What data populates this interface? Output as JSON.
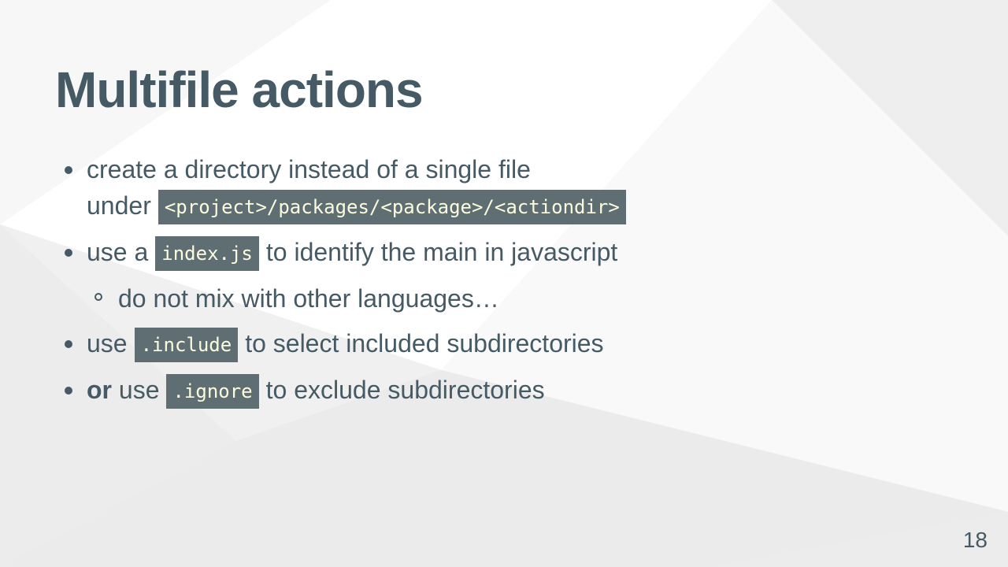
{
  "slide": {
    "title": "Multifile actions",
    "page_number": "18"
  },
  "bullets": {
    "b1": {
      "text1": "create a directory instead of a single file",
      "text2": "under",
      "code": "<project>/packages/<package>/<actiondir>"
    },
    "b2": {
      "pre": "use a",
      "code": "index.js",
      "post": "to identify the main in javascript",
      "sub": "do not mix with other languages…"
    },
    "b3": {
      "pre": "use",
      "code": ".include",
      "post": "to select included subdirectories"
    },
    "b4": {
      "bold": "or",
      "pre": "use",
      "code": ".ignore",
      "post": "to exclude subdirectories"
    }
  },
  "colors": {
    "text": "#455a64",
    "code_background": "#5f6e73",
    "code_text": "#fdfcdf",
    "background": "#f4f4f4"
  }
}
